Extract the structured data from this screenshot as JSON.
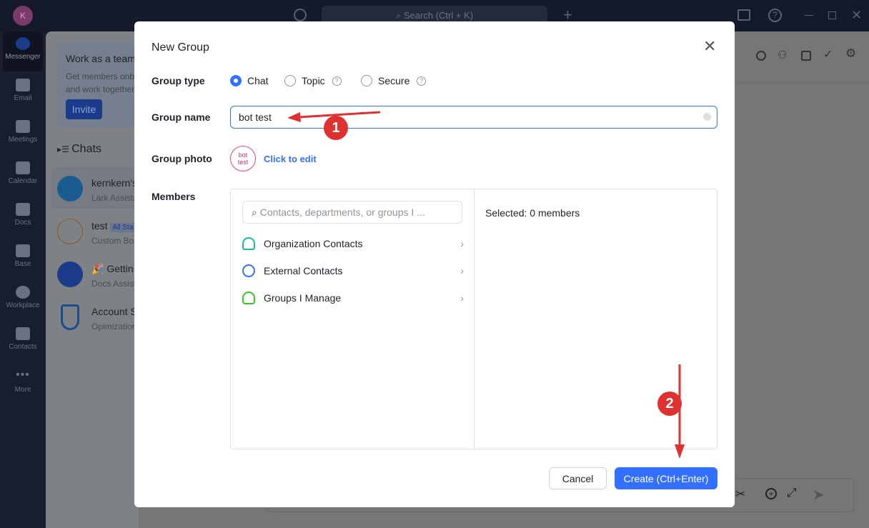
{
  "topbar": {
    "avatar_letter": "K",
    "search_placeholder": "Search (Ctrl + K)"
  },
  "rail": [
    {
      "label": "Messenger"
    },
    {
      "label": "Email"
    },
    {
      "label": "Meetings"
    },
    {
      "label": "Calendar"
    },
    {
      "label": "Docs"
    },
    {
      "label": "Base"
    },
    {
      "label": "Workplace"
    },
    {
      "label": "Contacts"
    },
    {
      "label": "More"
    }
  ],
  "promo": {
    "title": "Work as a team",
    "line1": "Get members onb",
    "line2": "and work together",
    "invite": "Invite"
  },
  "chats_header": "Chats",
  "chats": [
    {
      "title": "kernkern's",
      "sub": "Lark Assista",
      "color": "#2a6fa8"
    },
    {
      "title": "test",
      "badge": "All Sta",
      "sub": "Custom Bot",
      "color": "#8a7a62"
    },
    {
      "title": "Gettin",
      "sub": "Docs Assist",
      "color": "#2a4fa8"
    },
    {
      "title": "Account S",
      "sub": "Opimization",
      "color": "#7e8186"
    }
  ],
  "modal": {
    "title": "New Group",
    "group_type_label": "Group type",
    "types": [
      {
        "label": "Chat",
        "selected": true
      },
      {
        "label": "Topic",
        "selected": false,
        "help": "?"
      },
      {
        "label": "Secure",
        "selected": false,
        "help": "?"
      }
    ],
    "group_name_label": "Group name",
    "group_name_value": "bot test",
    "group_photo_label": "Group photo",
    "photo_text_1": "bot",
    "photo_text_2": "test",
    "click_to_edit": "Click to edit",
    "members_label": "Members",
    "search_placeholder": "Contacts, departments, or groups I ...",
    "sources": [
      {
        "label": "Organization Contacts",
        "color": "#14c0a0"
      },
      {
        "label": "External Contacts",
        "color": "#3370ff"
      },
      {
        "label": "Groups I Manage",
        "color": "#34c724"
      }
    ],
    "selected_text": "Selected: 0 members",
    "cancel": "Cancel",
    "create": "Create (Ctrl+Enter)"
  },
  "annotations": [
    "1",
    "2"
  ],
  "colors": {
    "accent": "#3370ff",
    "annotation": "#e03131"
  }
}
